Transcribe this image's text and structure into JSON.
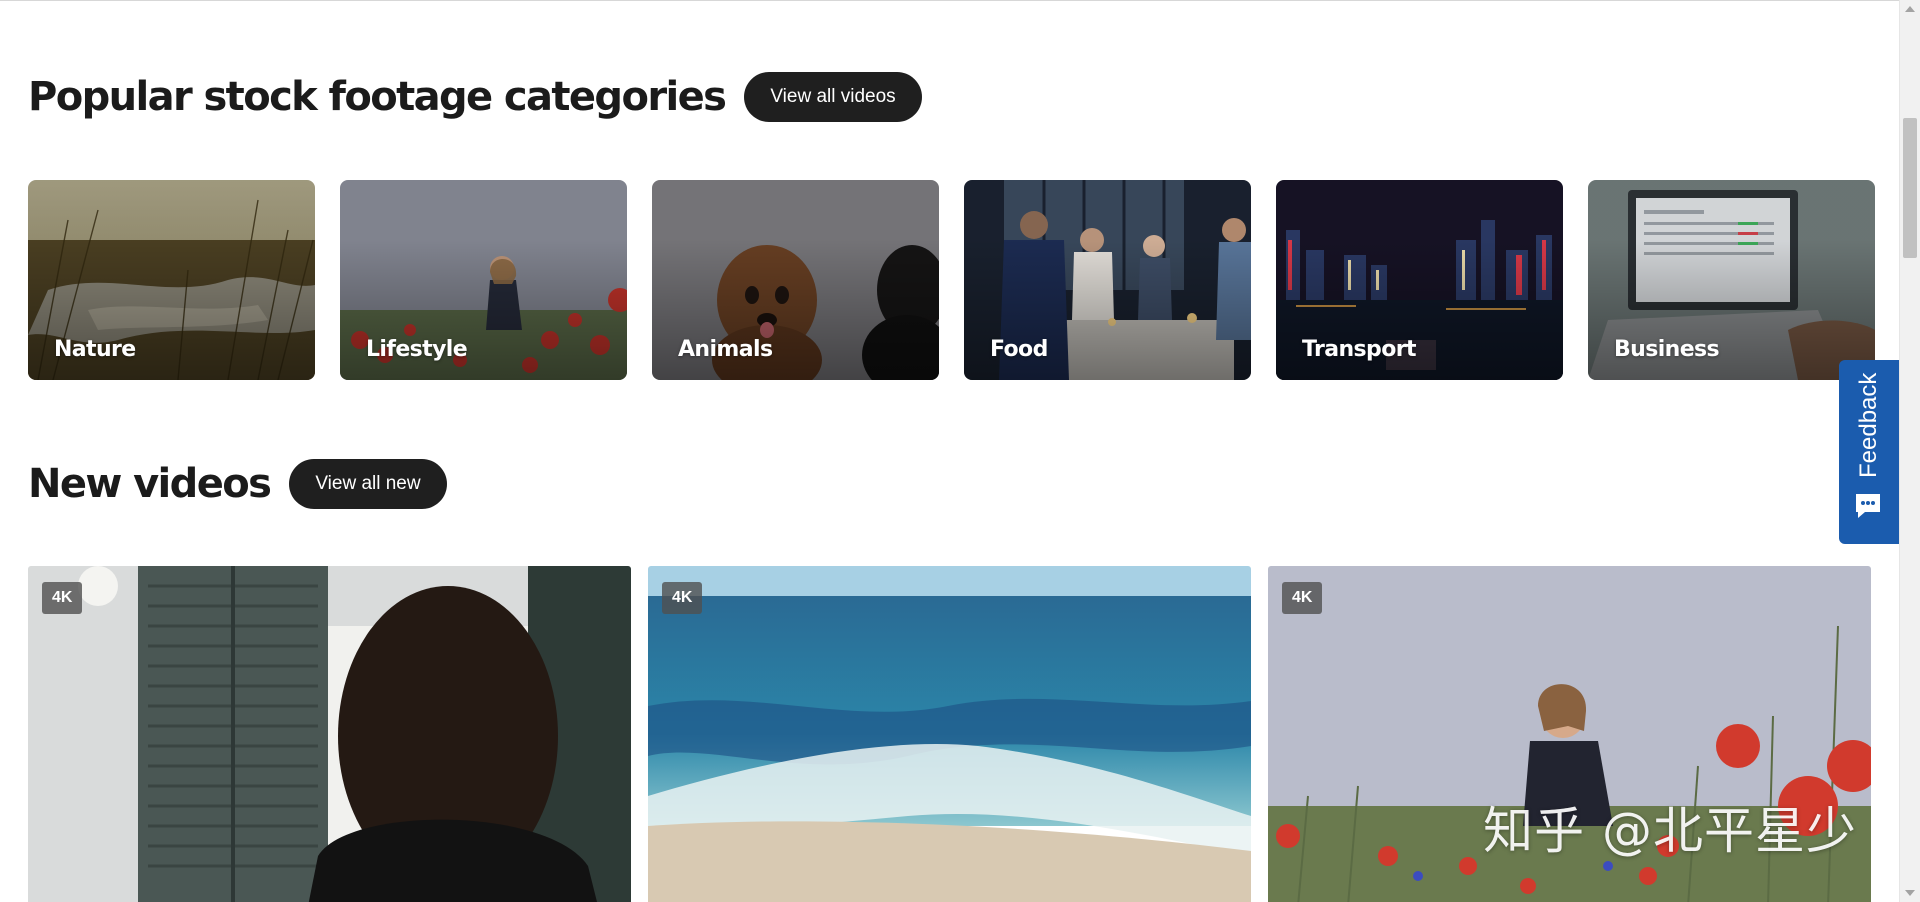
{
  "categories_section": {
    "title": "Popular stock footage categories",
    "button_label": "View all videos",
    "items": [
      {
        "label": "Nature"
      },
      {
        "label": "Lifestyle"
      },
      {
        "label": "Animals"
      },
      {
        "label": "Food"
      },
      {
        "label": "Transport"
      },
      {
        "label": "Business"
      }
    ]
  },
  "new_section": {
    "title": "New videos",
    "button_label": "View all new",
    "videos": [
      {
        "badge": "4K"
      },
      {
        "badge": "4K"
      },
      {
        "badge": "4K"
      }
    ]
  },
  "feedback": {
    "label": "Feedback",
    "color": "#1b5cae"
  },
  "watermark": {
    "text": "知乎 @北平星少"
  },
  "colors": {
    "pill_button_bg": "#1f1f1f",
    "page_bg": "#ffffff"
  }
}
